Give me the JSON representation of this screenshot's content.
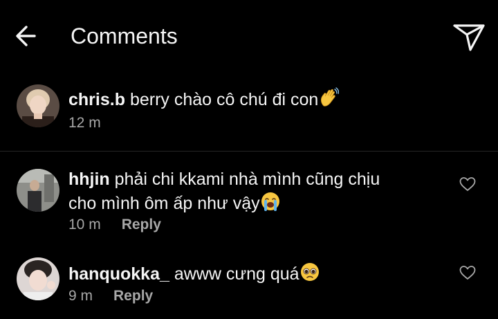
{
  "header": {
    "title": "Comments"
  },
  "caption": {
    "username": "chris.b",
    "text": "berry chào cô chú đi con",
    "emoji": "waving-hand",
    "time": "12 m"
  },
  "comments": [
    {
      "username": "hhjin",
      "line1": "phải chi kkami nhà mình cũng chịu",
      "line2": "cho mình ôm ấp như vậy",
      "emoji": "loudly-crying-face",
      "time": "10 m",
      "reply_label": "Reply"
    },
    {
      "username": "hanquokka_",
      "text": "awww cưng quá",
      "emoji": "pleading-face",
      "time": "9 m",
      "reply_label": "Reply"
    }
  ],
  "colors": {
    "background": "#000000",
    "text": "#f5f5f5",
    "secondary_text": "#a8a8a8",
    "divider": "#262626"
  }
}
